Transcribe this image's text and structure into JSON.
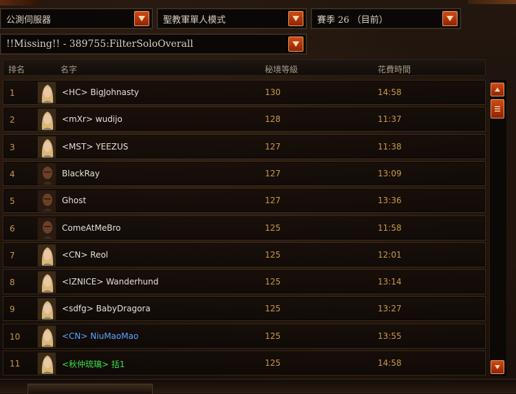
{
  "dropdowns": {
    "server": "公測伺服器",
    "mode": "聖教軍單人模式",
    "season": "賽季 26 （目前）",
    "filter": "!!Missing!! - 389755:FilterSoloOverall"
  },
  "columns": {
    "rank": "排名",
    "name": "名字",
    "level": "秘境等級",
    "time": "花費時間"
  },
  "rows": [
    {
      "rank": "1",
      "name": "<HC> BigJohnasty",
      "level": "130",
      "time": "14:58",
      "portrait": "female",
      "style": "normal"
    },
    {
      "rank": "2",
      "name": "<mXr> wudijo",
      "level": "128",
      "time": "11:37",
      "portrait": "female",
      "style": "normal"
    },
    {
      "rank": "3",
      "name": "<MST> YEEZUS",
      "level": "127",
      "time": "11:38",
      "portrait": "female",
      "style": "normal"
    },
    {
      "rank": "4",
      "name": "BlackRay",
      "level": "127",
      "time": "13:09",
      "portrait": "male",
      "style": "normal"
    },
    {
      "rank": "5",
      "name": "Ghost",
      "level": "127",
      "time": "13:36",
      "portrait": "male",
      "style": "normal"
    },
    {
      "rank": "6",
      "name": "ComeAtMeBro",
      "level": "125",
      "time": "11:58",
      "portrait": "male",
      "style": "normal"
    },
    {
      "rank": "7",
      "name": "<CN> Reol",
      "level": "125",
      "time": "12:01",
      "portrait": "female",
      "style": "normal"
    },
    {
      "rank": "8",
      "name": "<IZNICE> Wanderhund",
      "level": "125",
      "time": "13:14",
      "portrait": "female",
      "style": "normal"
    },
    {
      "rank": "9",
      "name": "<sdfg> BabyDragora",
      "level": "125",
      "time": "13:27",
      "portrait": "female",
      "style": "normal"
    },
    {
      "rank": "10",
      "name": "<CN> NiuMaoMao",
      "level": "125",
      "time": "13:55",
      "portrait": "female",
      "style": "blue"
    },
    {
      "rank": "11",
      "name": "<秋仲琉璃> 括1",
      "level": "125",
      "time": "14:58",
      "portrait": "female",
      "style": "green"
    }
  ],
  "icons": {
    "dropdown": "chevron-down-icon",
    "scroll_up": "triangle-up-icon",
    "scroll_down": "triangle-down-icon",
    "scroll_thumb": "grip-icon"
  },
  "colors": {
    "accent": "#c8461a",
    "value_text": "#c89a4a",
    "name_text": "#e6e0d6",
    "name_blue": "#5ea3ff",
    "name_green": "#3ae04a"
  }
}
